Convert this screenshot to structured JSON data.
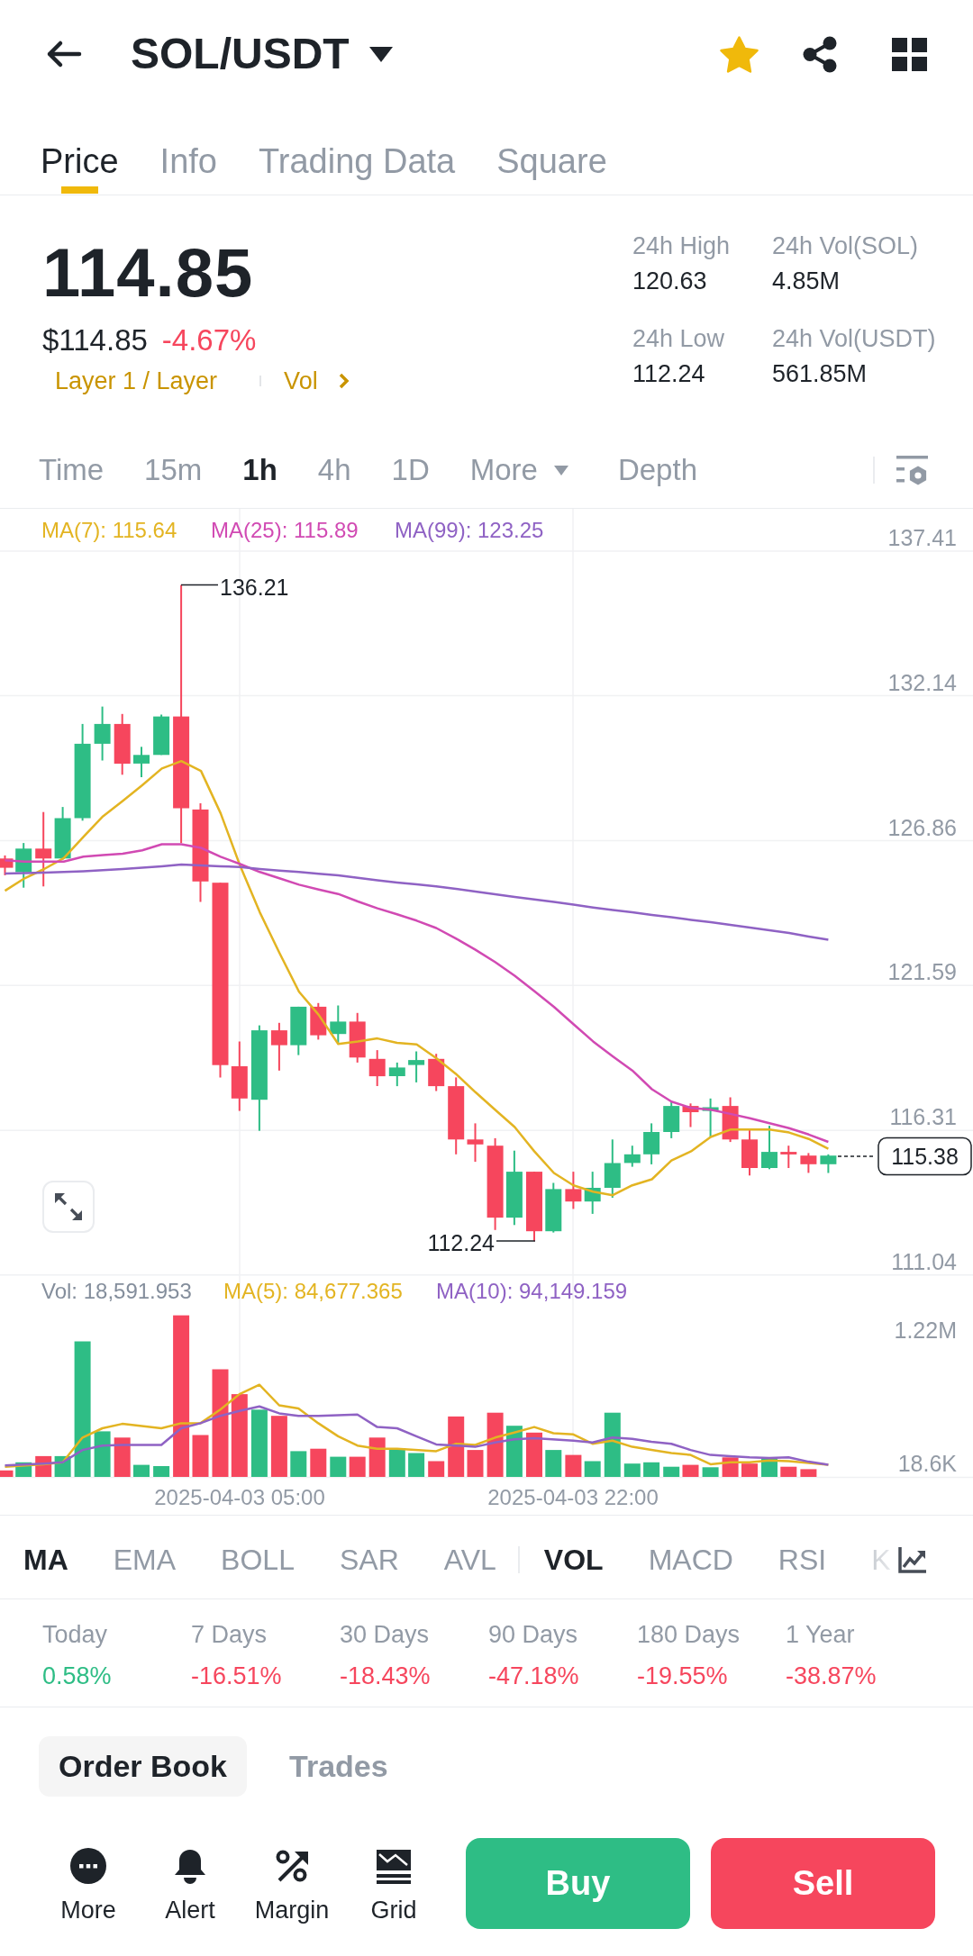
{
  "header": {
    "title": "SOL/USDT",
    "favorite": true
  },
  "tabs": [
    {
      "label": "Price",
      "selected": true
    },
    {
      "label": "Info",
      "selected": false
    },
    {
      "label": "Trading Data",
      "selected": false
    },
    {
      "label": "Square",
      "selected": false
    }
  ],
  "ticker": {
    "last_price": "114.85",
    "fiat_price": "$114.85",
    "change": "-4.67%",
    "change_positive": false,
    "tags": [
      {
        "label": "Layer 1 / Layer",
        "kind": "tag"
      },
      {
        "label": "Vol",
        "kind": "link"
      }
    ],
    "stats": [
      {
        "label": "24h High",
        "value": "120.63"
      },
      {
        "label": "24h Vol(SOL)",
        "value": "4.85M"
      },
      {
        "label": "24h Low",
        "value": "112.24"
      },
      {
        "label": "24h Vol(USDT)",
        "value": "561.85M"
      }
    ]
  },
  "intervals": [
    {
      "label": "Time",
      "kind": "interval",
      "selected": false
    },
    {
      "label": "15m",
      "kind": "interval",
      "selected": false
    },
    {
      "label": "1h",
      "kind": "interval",
      "selected": true
    },
    {
      "label": "4h",
      "kind": "interval",
      "selected": false
    },
    {
      "label": "1D",
      "kind": "interval",
      "selected": false
    },
    {
      "label": "More",
      "kind": "dropdown",
      "selected": false
    },
    {
      "label": "Depth",
      "kind": "view",
      "selected": false
    }
  ],
  "chart": {
    "chart_data": {
      "type": "line",
      "ylim": [
        110.97,
        138.95
      ],
      "yticks": [
        137.41,
        132.14,
        126.86,
        121.59,
        116.31,
        111.04
      ],
      "grid": true,
      "series": [
        {
          "name": "MA(7): 115.64",
          "color": "#e3b422",
          "values": [
            125.04,
            125.49,
            125.83,
            126.23,
            127,
            127.75,
            128.31,
            128.88,
            129.49,
            129.76,
            129.4,
            127.86,
            125.94,
            124.25,
            122.78,
            121.36,
            120.52,
            119.46,
            119.55,
            119.66,
            119.5,
            119.44,
            118.94,
            118.37,
            117.7,
            117.06,
            116.43,
            115.55,
            114.76,
            114.31,
            114.08,
            113.95,
            114.31,
            114.53,
            115.21,
            115.55,
            116.07,
            116.34,
            116.34,
            116.34,
            116.23,
            116,
            115.64
          ]
        },
        {
          "name": "MA(25): 115.89",
          "color": "#d14ab3",
          "values": [
            126.15,
            126.1,
            126.1,
            126.1,
            126.28,
            126.34,
            126.39,
            126.51,
            126.73,
            126.73,
            126.6,
            126.28,
            126.01,
            125.72,
            125.49,
            125.26,
            125.08,
            124.92,
            124.65,
            124.4,
            124.18,
            123.95,
            123.68,
            123.3,
            122.89,
            122.44,
            121.94,
            121.38,
            120.81,
            120.18,
            119.55,
            119.01,
            118.49,
            117.81,
            117.36,
            117.13,
            117.06,
            116.91,
            116.75,
            116.57,
            116.39,
            116.16,
            115.89
          ]
        },
        {
          "name": "MA(99): 123.25",
          "color": "#8f62c4",
          "values": [
            125.67,
            125.68,
            125.7,
            125.72,
            125.75,
            125.79,
            125.83,
            125.88,
            125.93,
            125.99,
            125.96,
            125.93,
            125.9,
            125.83,
            125.77,
            125.72,
            125.66,
            125.6,
            125.51,
            125.42,
            125.34,
            125.27,
            125.2,
            125.11,
            125.01,
            124.91,
            124.81,
            124.72,
            124.63,
            124.53,
            124.43,
            124.34,
            124.25,
            124.16,
            124.07,
            123.98,
            123.89,
            123.8,
            123.7,
            123.6,
            123.5,
            123.37,
            123.25
          ]
        }
      ]
    },
    "high_label": "136.21",
    "low_label": "112.24",
    "last_price_tag": "115.38"
  },
  "volume": {
    "legend": [
      {
        "label": "Vol: 18,591.953",
        "color": "#848e9c"
      },
      {
        "label": "MA(5): 84,677.365",
        "color": "#e3b422"
      },
      {
        "label": "MA(10): 94,149.159",
        "color": "#8f62c4"
      }
    ],
    "axis": [
      "1.22M",
      "18.6K"
    ],
    "time_axis": [
      "2025-04-03 05:00",
      "2025-04-03 22:00"
    ]
  },
  "indicators": {
    "main": [
      {
        "label": "MA",
        "selected": true
      },
      {
        "label": "EMA",
        "selected": false
      },
      {
        "label": "BOLL",
        "selected": false
      },
      {
        "label": "SAR",
        "selected": false
      },
      {
        "label": "AVL",
        "selected": false
      }
    ],
    "sub": [
      {
        "label": "VOL",
        "selected": true
      },
      {
        "label": "MACD",
        "selected": false
      },
      {
        "label": "RSI",
        "selected": false
      },
      {
        "label": "K",
        "selected": false
      }
    ]
  },
  "performance": [
    {
      "label": "Today",
      "value": "0.58%",
      "positive": true
    },
    {
      "label": "7 Days",
      "value": "-16.51%",
      "positive": false
    },
    {
      "label": "30 Days",
      "value": "-18.43%",
      "positive": false
    },
    {
      "label": "90 Days",
      "value": "-47.18%",
      "positive": false
    },
    {
      "label": "180 Days",
      "value": "-19.55%",
      "positive": false
    },
    {
      "label": "1 Year",
      "value": "-38.87%",
      "positive": false
    }
  ],
  "book_tabs": [
    {
      "label": "Order Book",
      "selected": true
    },
    {
      "label": "Trades",
      "selected": false
    }
  ],
  "actions": [
    {
      "label": "More"
    },
    {
      "label": "Alert"
    },
    {
      "label": "Margin"
    },
    {
      "label": "Grid"
    }
  ],
  "trade_buttons": [
    {
      "label": "Buy",
      "kind": "buy"
    },
    {
      "label": "Sell",
      "kind": "sell"
    }
  ]
}
